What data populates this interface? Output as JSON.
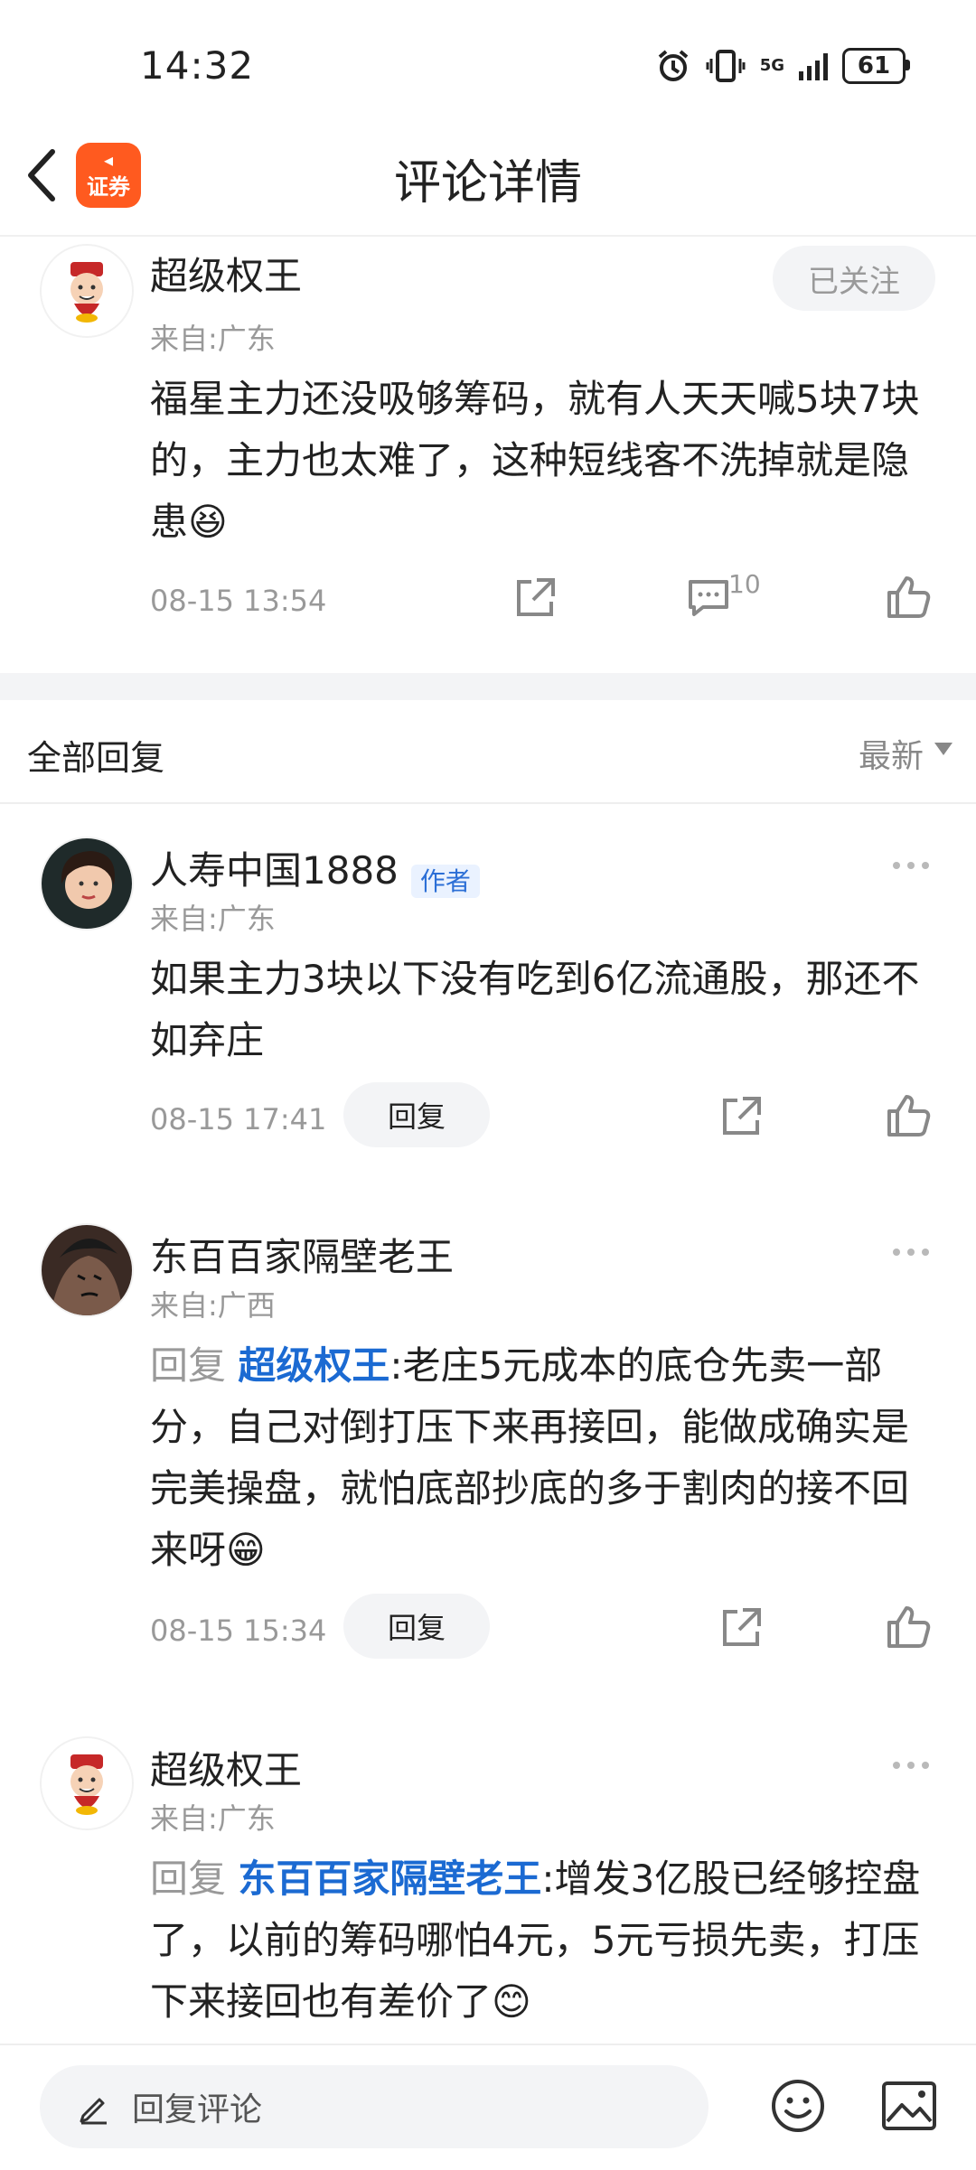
{
  "status_bar": {
    "time": "14:32",
    "network": "5G",
    "battery": "61"
  },
  "header": {
    "title": "评论详情",
    "logo_label": "证券",
    "logo_color": "#ff5a1f"
  },
  "post": {
    "author": "超级权王",
    "location": "来自:广东",
    "follow_label": "已关注",
    "text": "福星主力还没吸够筹码，就有人天天喊5块7块的，主力也太难了，这种短线客不洗掉就是隐患",
    "emoji": "😆",
    "time": "08-15 13:54",
    "comment_count": "10"
  },
  "replies_section": {
    "title": "全部回复",
    "sort_label": "最新"
  },
  "replies": [
    {
      "author": "人寿中国1888",
      "badge": "作者",
      "location": "来自:广东",
      "text": "如果主力3块以下没有吃到6亿流通股，那还不如弃庄",
      "time": "08-15 17:41",
      "reply_label": "回复"
    },
    {
      "author": "东百百家隔壁老王",
      "location": "来自:广西",
      "reply_prefix": "回复",
      "reply_to": "超级权王",
      "text": ":老庄5元成本的底仓先卖一部分，自己对倒打压下来再接回，能做成确实是完美操盘，就怕底部抄底的多于割肉的接不回来呀",
      "emoji": "😁",
      "time": "08-15 15:34",
      "reply_label": "回复"
    },
    {
      "author": "超级权王",
      "location": "来自:广东",
      "reply_prefix": "回复",
      "reply_to": "东百百家隔壁老王",
      "text": ":增发3亿股已经够控盘了，以前的筹码哪怕4元，5元亏损先卖，打压下来接回也有差价了",
      "emoji": "😊"
    }
  ],
  "bottom_bar": {
    "placeholder": "回复评论"
  },
  "colors": {
    "accent_blue": "#1b6ad2",
    "muted": "#999999"
  }
}
